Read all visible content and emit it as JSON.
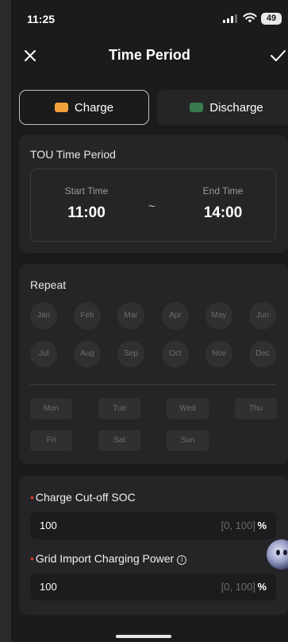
{
  "status_bar": {
    "time": "11:25",
    "battery": "49"
  },
  "header": {
    "title": "Time Period"
  },
  "tabs": [
    {
      "label": "Charge",
      "active": true,
      "icon": "battery-charge-icon",
      "color": "#f2a13a"
    },
    {
      "label": "Discharge",
      "active": false,
      "icon": "battery-discharge-icon",
      "color": "#3a7a4e"
    }
  ],
  "tou": {
    "title": "TOU Time Period",
    "start_label": "Start Time",
    "start_value": "11:00",
    "separator": "~",
    "end_label": "End Time",
    "end_value": "14:00"
  },
  "repeat": {
    "title": "Repeat",
    "months": [
      "Jan",
      "Feb",
      "Mar",
      "Apr",
      "May",
      "Jun",
      "Jul",
      "Aug",
      "Sep",
      "Oct",
      "Nov",
      "Dec"
    ],
    "days": [
      "Mon",
      "Tue",
      "Wed",
      "Thu",
      "Fri",
      "Sat",
      "Sun"
    ]
  },
  "soc": {
    "label": "Charge Cut-off SOC",
    "value": "100",
    "range": "[0, 100]",
    "unit": "%"
  },
  "grid": {
    "label": "Grid Import Charging Power",
    "value": "100",
    "range": "[0, 100]",
    "unit": "%"
  },
  "required_marker": "•",
  "info_glyph": "i"
}
